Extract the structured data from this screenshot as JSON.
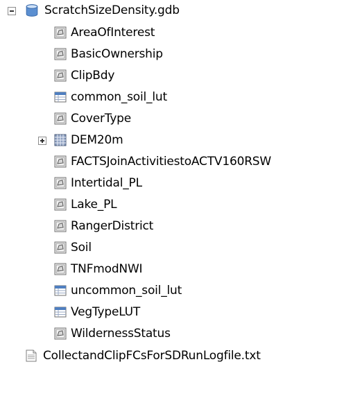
{
  "tree": {
    "root": {
      "label": "ScratchSizeDensity.gdb",
      "icon": "database-cylinder-icon",
      "expanded": true
    },
    "children": [
      {
        "label": "AreaOfInterest",
        "icon": "polygon-featureclass-icon"
      },
      {
        "label": "BasicOwnership",
        "icon": "polygon-featureclass-icon"
      },
      {
        "label": "ClipBdy",
        "icon": "polygon-featureclass-icon"
      },
      {
        "label": "common_soil_lut",
        "icon": "table-icon"
      },
      {
        "label": "CoverType",
        "icon": "polygon-featureclass-icon"
      },
      {
        "label": "DEM20m",
        "icon": "raster-grid-icon",
        "expanded": false
      },
      {
        "label": "FACTSJoinActivitiestoACTV160RSW",
        "icon": "polygon-featureclass-icon"
      },
      {
        "label": "Intertidal_PL",
        "icon": "polygon-featureclass-icon"
      },
      {
        "label": "Lake_PL",
        "icon": "polygon-featureclass-icon"
      },
      {
        "label": "RangerDistrict",
        "icon": "polygon-featureclass-icon"
      },
      {
        "label": "Soil",
        "icon": "polygon-featureclass-icon"
      },
      {
        "label": "TNFmodNWI",
        "icon": "polygon-featureclass-icon"
      },
      {
        "label": "uncommon_soil_lut",
        "icon": "table-icon"
      },
      {
        "label": "VegTypeLUT",
        "icon": "table-icon"
      },
      {
        "label": "WildernessStatus",
        "icon": "polygon-featureclass-icon"
      }
    ],
    "sibling": {
      "label": "CollectandClipFCsForSDRunLogfile.txt",
      "icon": "text-file-icon"
    }
  },
  "colors": {
    "database": "#5b8fd1",
    "featureclass_border": "#6d6d6d",
    "table_header": "#4f7fc0",
    "raster": "#5a6c8f"
  }
}
